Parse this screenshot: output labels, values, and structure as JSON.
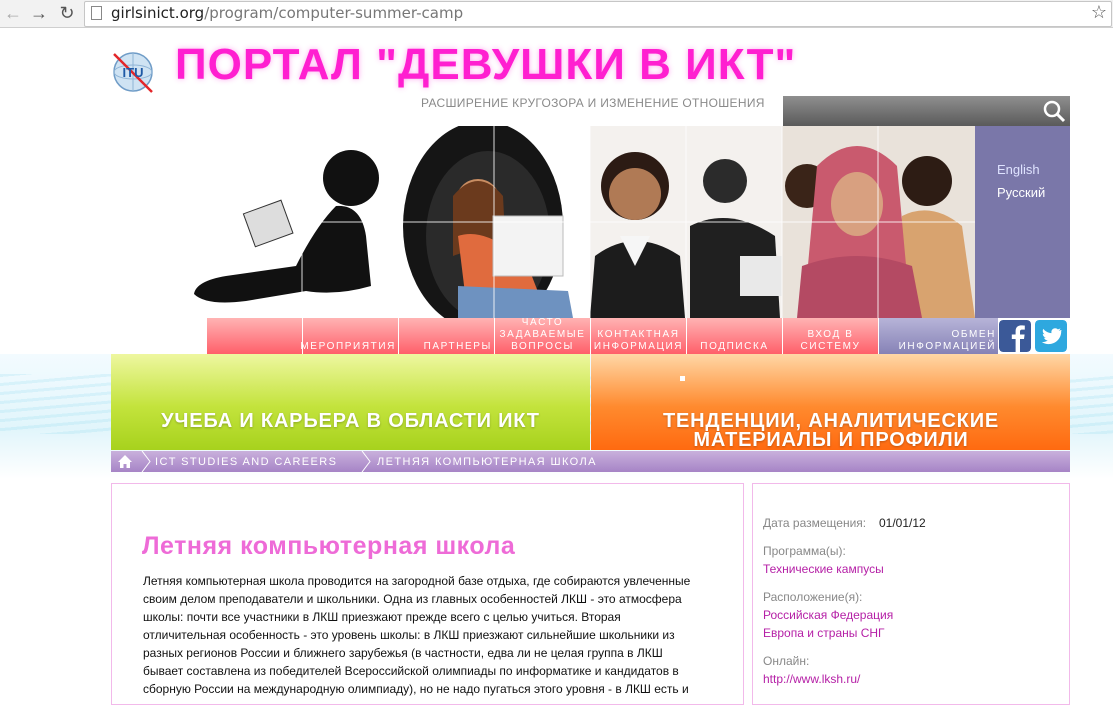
{
  "browser": {
    "url_domain": "girlsinict.org",
    "url_path": "/program/computer-summer-camp"
  },
  "header": {
    "title": "ПОРТАЛ \"ДЕВУШКИ В ИКТ\"",
    "tagline": "РАСШИРЕНИЕ КРУГОЗОРА И ИЗМЕНЕНИЕ ОТНОШЕНИЯ",
    "logo_text": "ITU",
    "search_placeholder": ""
  },
  "languages": [
    "English",
    "Русский"
  ],
  "menu": [
    {
      "label": ""
    },
    {
      "label": "МЕРОПРИЯТИЯ"
    },
    {
      "label": "ПАРТНЕРЫ"
    },
    {
      "label": "ЧАСТО ЗАДАВАЕМЫЕ ВОПРОСЫ"
    },
    {
      "label": "КОНТАКТНАЯ ИНФОРМАЦИЯ"
    },
    {
      "label": "ПОДПИСКА"
    },
    {
      "label": "ВХОД В СИСТЕМУ"
    },
    {
      "label": "ОБМЕН ИНФОРМАЦИЕЙ"
    }
  ],
  "categories": {
    "left": "УЧЕБА И КАРЬЕРА В ОБЛАСТИ ИКТ",
    "right": "ТЕНДЕНЦИИ, АНАЛИТИЧЕСКИЕ МАТЕРИАЛЫ И ПРОФИЛИ"
  },
  "breadcrumb": {
    "items": [
      "ICT STUDIES AND CAREERS",
      "ЛЕТНЯЯ КОМПЬЮТЕРНАЯ ШКОЛА"
    ]
  },
  "article": {
    "title": "Летняя компьютерная школа",
    "lines": [
      "Летняя компьютерная школа проводится на загородной базе отдыха, где собираются увлеченные",
      "своим делом преподаватели и школьники. Одна из главных особенностей ЛКШ - это атмосфера",
      "школы: почти все участники в ЛКШ приезжают прежде всего с целью учиться. Вторая",
      "отличительная особенность - это уровень школы: в ЛКШ приезжают сильнейшие школьники из",
      "разных регионов России и ближнего зарубежья (в частности, едва ли не целая группа в ЛКШ",
      "бывает составлена из победителей Всероссийской олимпиады по информатике и кандидатов в",
      "сборную России на международную олимпиаду), но не надо пугаться этого уровня - в ЛКШ есть и"
    ]
  },
  "sidebar": {
    "posted_label": "Дата размещения:",
    "posted_value": "01/01/12",
    "program_label": "Программа(ы):",
    "program_value": "Технические кампусы",
    "location_label": "Расположение(я):",
    "location_values": [
      "Российская Федерация",
      "Европа и страны СНГ"
    ],
    "online_label": "Онлайн:",
    "online_value": "http://www.lksh.ru/"
  },
  "colors": {
    "title_pink": "#ff1fd0",
    "menu_red": "#ff5f6a",
    "menu_purple": "#8682b6",
    "green": "#a7d21d",
    "orange": "#ff6a10",
    "link": "#b51fa6"
  }
}
